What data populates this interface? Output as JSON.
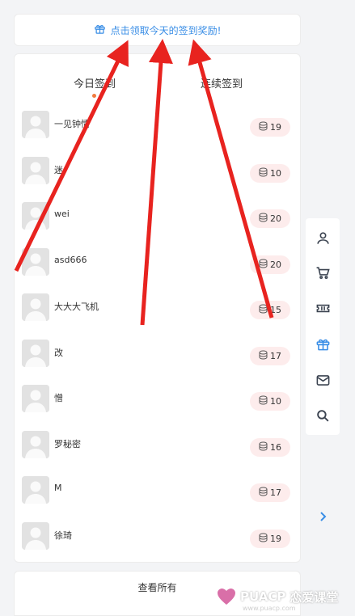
{
  "banner": {
    "text": "点击领取今天的签到奖励!",
    "icon": "gift-icon",
    "color": "#3a8ee6"
  },
  "tabs": [
    {
      "label": "今日签到",
      "active": true
    },
    {
      "label": "连续签到",
      "active": false
    }
  ],
  "users": [
    {
      "name": "一见钟情",
      "points": "19"
    },
    {
      "name": "迷",
      "points": "10"
    },
    {
      "name": "wei",
      "points": "20"
    },
    {
      "name": "asd666",
      "points": "20"
    },
    {
      "name": "大大大飞机",
      "points": "15"
    },
    {
      "name": "改",
      "points": "17"
    },
    {
      "name": "憎",
      "points": "10"
    },
    {
      "name": "罗秘密",
      "points": "16"
    },
    {
      "name": "M",
      "points": "17"
    },
    {
      "name": "徐琦",
      "points": "19"
    }
  ],
  "view_all": "查看所有",
  "side_toolbar": [
    "user-icon",
    "cart-icon",
    "ticket-icon",
    "gift-icon",
    "mail-icon",
    "search-icon"
  ],
  "side_next": "chevron-right-icon",
  "watermark": {
    "brand": "PUACP",
    "name": "恋爱课堂",
    "site": "www.puacp.com"
  },
  "colors": {
    "accent": "#3a8ee6",
    "pill_bg": "#fdecec",
    "arrow": "#e8231f",
    "tab_dot": "#f07b3f"
  }
}
